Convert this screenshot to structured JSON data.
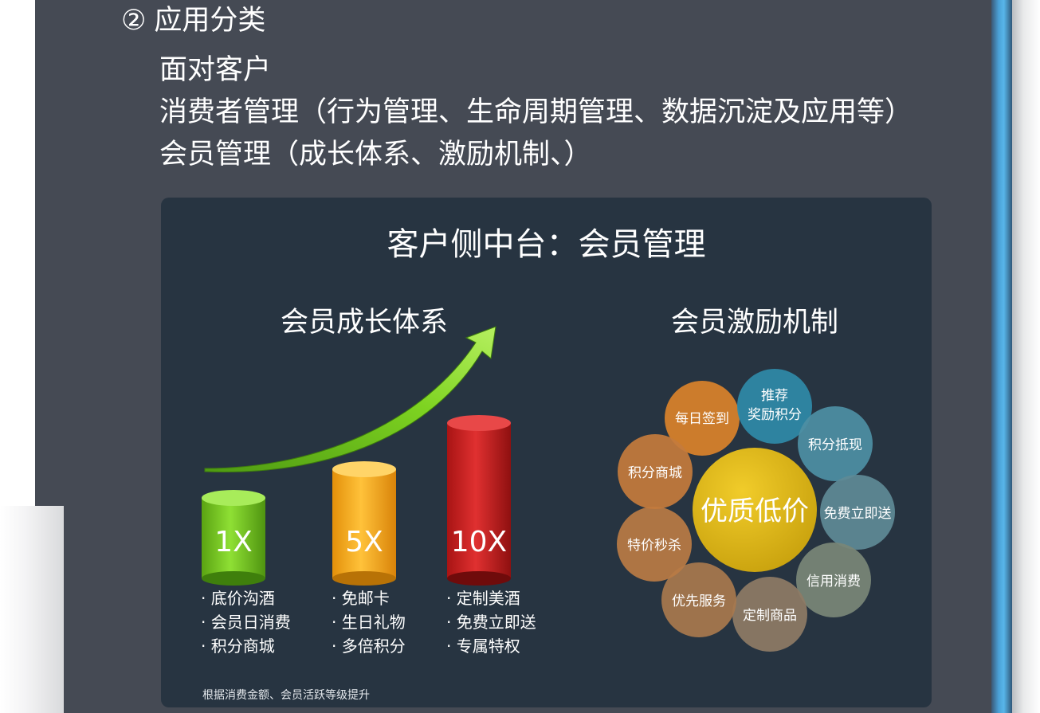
{
  "header": {
    "number": "②",
    "title": "应用分类",
    "lines": [
      "面对客户",
      "消费者管理（行为管理、生命周期管理、数据沉淀及应用等）",
      "会员管理（成长体系、激励机制、）"
    ]
  },
  "panel": {
    "title": "客户侧中台：会员管理",
    "growth": {
      "title": "会员成长体系",
      "tiers": [
        {
          "label": "1X",
          "color": "#7ed321",
          "benefits": [
            "底价沟酒",
            "会员日消费",
            "积分商城"
          ]
        },
        {
          "label": "5X",
          "color": "#f7a51c",
          "benefits": [
            "免邮卡",
            "生日礼物",
            "多倍积分"
          ]
        },
        {
          "label": "10X",
          "color": "#c81e1e",
          "benefits": [
            "定制美酒",
            "免费立即送",
            "专属特权"
          ]
        }
      ],
      "footnote": "根据消费金额、会员活跃等级提升"
    },
    "incentive": {
      "title": "会员激励机制",
      "center": "优质低价",
      "items": [
        {
          "label": "每日签到",
          "color": "#d9822b"
        },
        {
          "label": "推荐\n奖励积分",
          "color": "#2f8aa8"
        },
        {
          "label": "积分抵现",
          "color": "#4d8fa4"
        },
        {
          "label": "免费立即送",
          "color": "#5f8a96"
        },
        {
          "label": "信用消费",
          "color": "#7a8777"
        },
        {
          "label": "定制商品",
          "color": "#8e7b65"
        },
        {
          "label": "优先服务",
          "color": "#a8784d"
        },
        {
          "label": "特价秒杀",
          "color": "#b97b45"
        },
        {
          "label": "积分商城",
          "color": "#c47b3c"
        }
      ]
    }
  }
}
